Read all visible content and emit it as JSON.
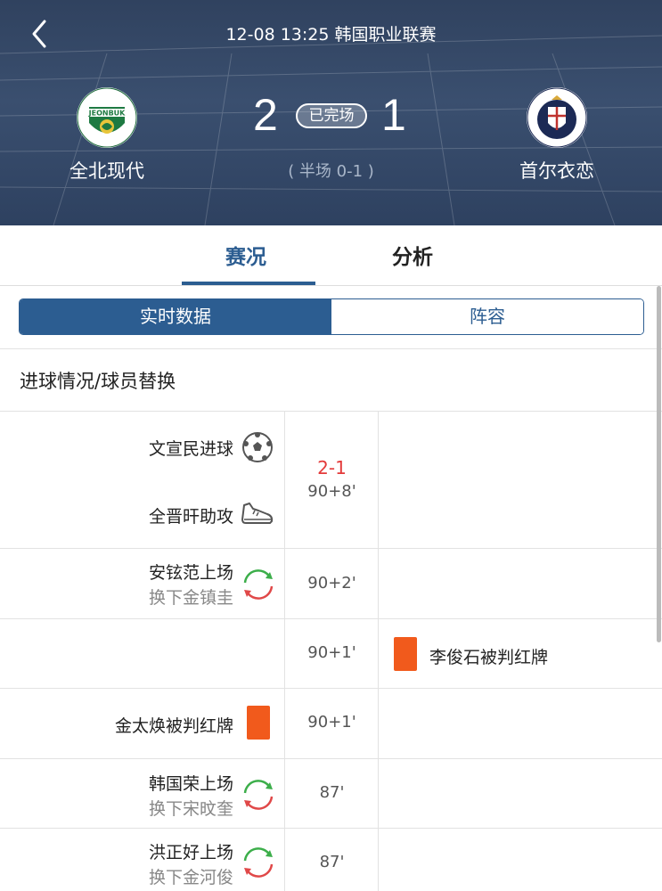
{
  "header": {
    "match_info": "12-08 13:25 韩国职业联赛",
    "home_team": "全北现代",
    "away_team": "首尔衣恋",
    "home_score": "2",
    "away_score": "1",
    "status": "已完场",
    "halftime": "( 半场 0-1 )"
  },
  "tabs": [
    "赛况",
    "分析"
  ],
  "segment": [
    "实时数据",
    "阵容"
  ],
  "section_title": "进球情况/球员替换",
  "events": [
    {
      "goal": "文宣民进球",
      "assist": "全晋旰助攻",
      "score": "2-1",
      "time": "90+8'"
    },
    {
      "sub_in": "安铉范上场",
      "sub_out": "换下金镇圭",
      "time": "90+2'"
    },
    {
      "away_card": "李俊石被判红牌",
      "time": "90+1'"
    },
    {
      "home_card": "金太焕被判红牌",
      "time": "90+1'"
    },
    {
      "sub_in": "韩国荣上场",
      "sub_out": "换下宋旼奎",
      "time": "87'"
    },
    {
      "sub_in": "洪正好上场",
      "sub_out": "换下金河俊",
      "time": "87'"
    }
  ],
  "colors": {
    "accent": "#2c5d91",
    "header_bg": "#34486a",
    "red_card": "#f15a1c",
    "goal_score": "#e33a3a",
    "sub_in_green": "#3cae4a",
    "sub_out_red": "#e04848"
  }
}
